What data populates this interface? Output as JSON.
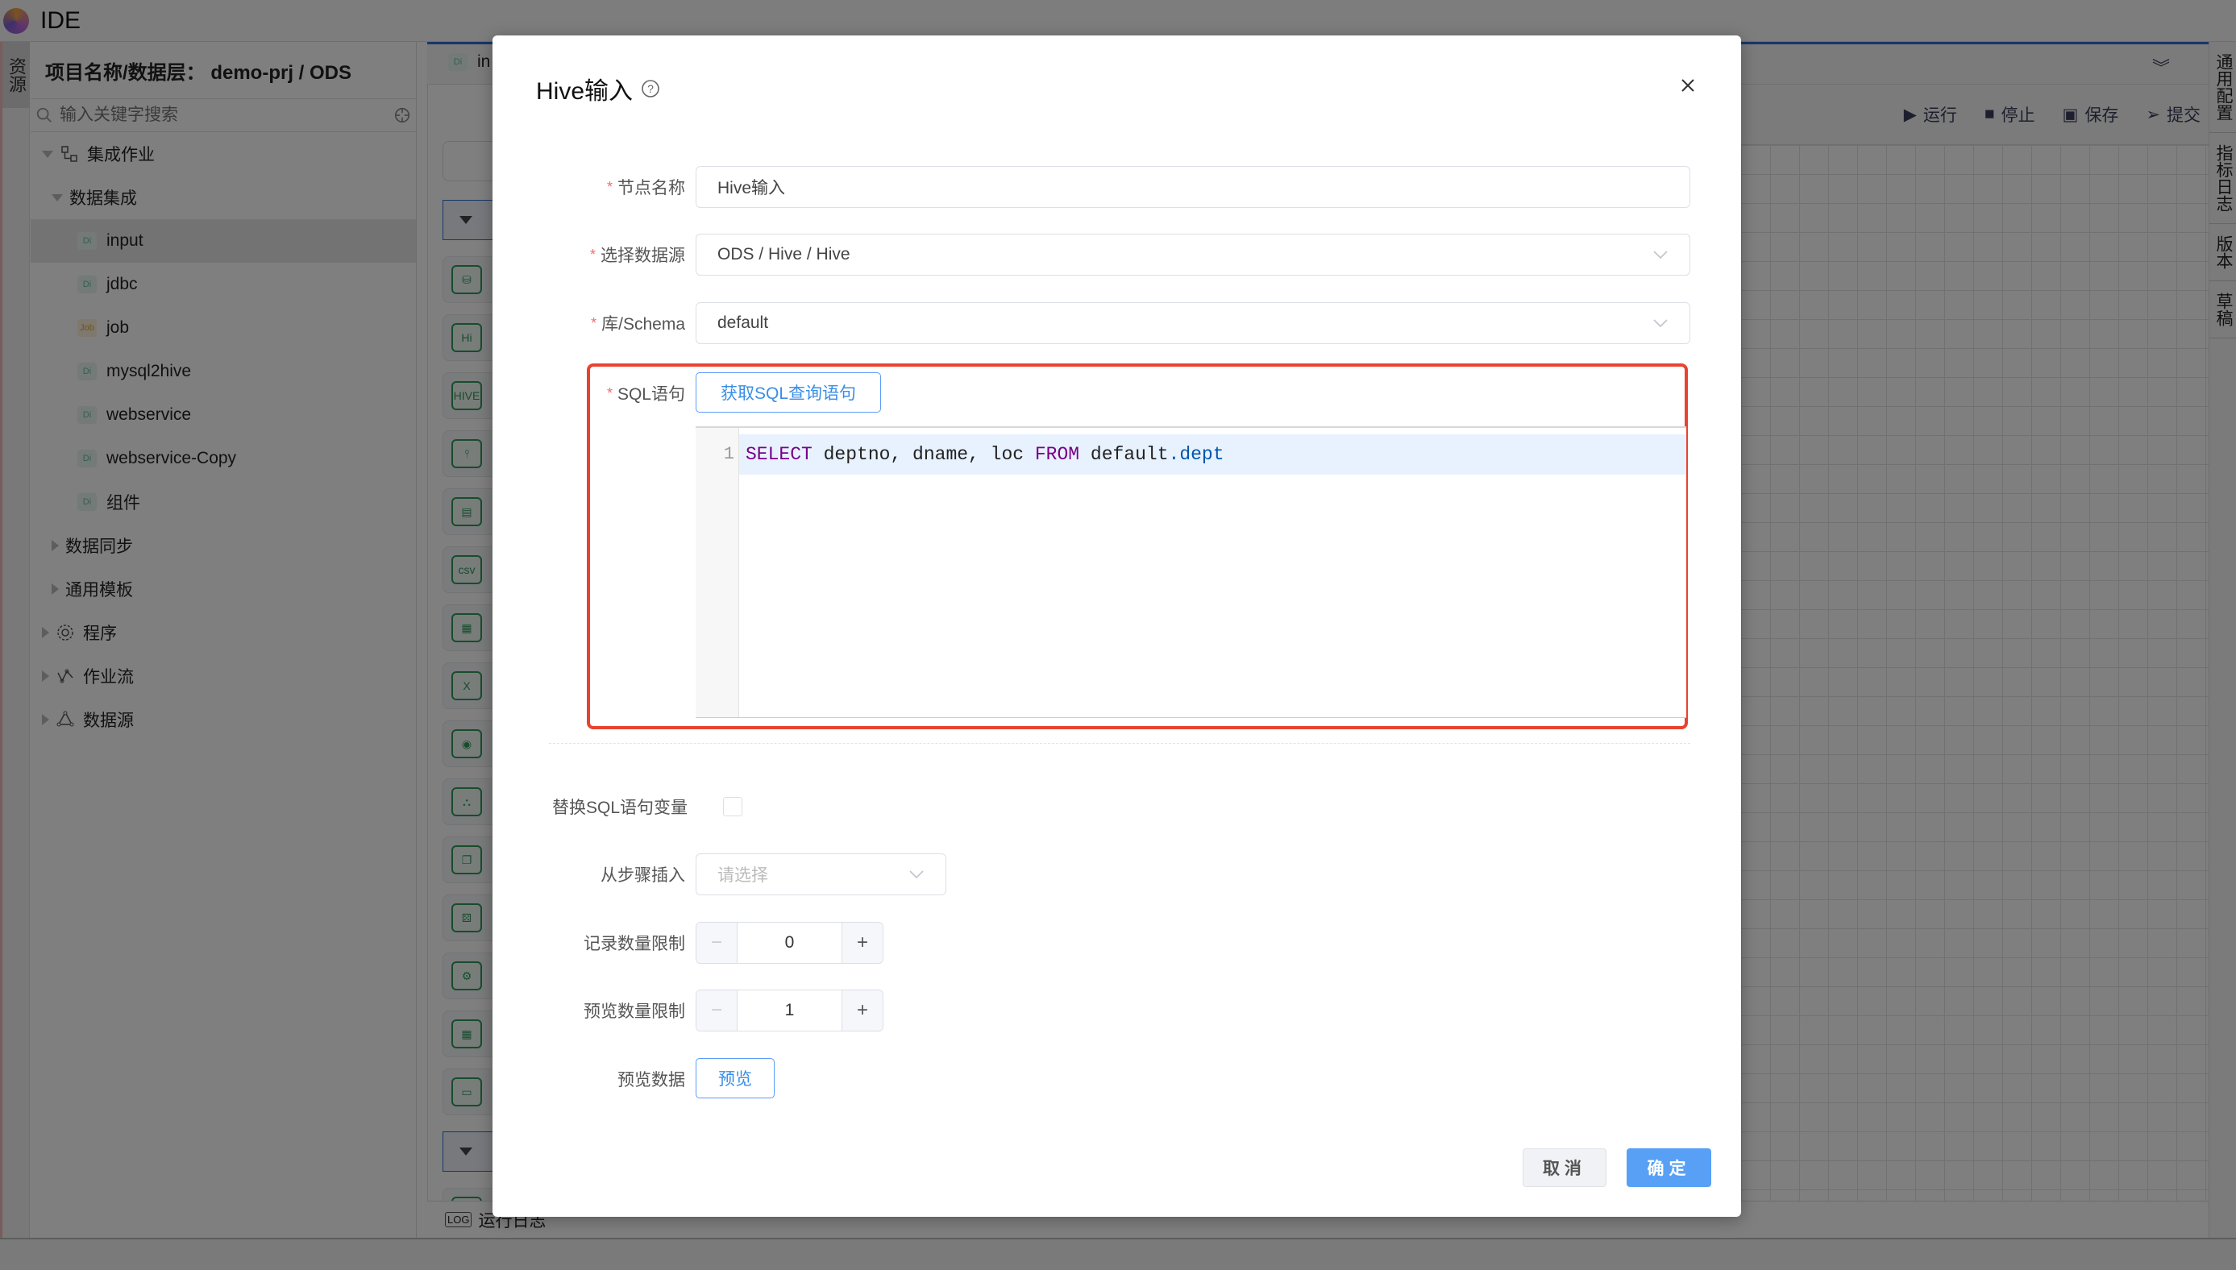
{
  "app": {
    "title": "IDE"
  },
  "left_strip": {
    "tab_label": "资源"
  },
  "resource_panel": {
    "header": "项目名称/数据层：  demo-prj / ODS",
    "search_placeholder": "输入关键字搜索",
    "tree": [
      {
        "label": "集成作业",
        "level": 0,
        "expanded": true,
        "icon": "integration-icon"
      },
      {
        "label": "数据集成",
        "level": 1,
        "expanded": true
      },
      {
        "label": "input",
        "level": 2,
        "badge": "Di",
        "selected": true
      },
      {
        "label": "jdbc",
        "level": 2,
        "badge": "Di"
      },
      {
        "label": "job",
        "level": 2,
        "badge": "Job"
      },
      {
        "label": "mysql2hive",
        "level": 2,
        "badge": "Di"
      },
      {
        "label": "webservice",
        "level": 2,
        "badge": "Di"
      },
      {
        "label": "webservice-Copy",
        "level": 2,
        "badge": "Di"
      },
      {
        "label": "组件",
        "level": 2,
        "badge": "Di"
      },
      {
        "label": "数据同步",
        "level": 1,
        "expanded": false
      },
      {
        "label": "通用模板",
        "level": 1,
        "expanded": false
      },
      {
        "label": "程序",
        "level": 0,
        "expanded": false,
        "icon": "gear-icon"
      },
      {
        "label": "作业流",
        "level": 0,
        "expanded": false,
        "icon": "workflow-icon"
      },
      {
        "label": "数据源",
        "level": 0,
        "expanded": false,
        "icon": "datasource-icon"
      }
    ]
  },
  "editor_tab": {
    "badge": "Di",
    "label": "in"
  },
  "component_panel": {
    "items": [
      {
        "icon": "db-input-icon",
        "glyph": "⛁"
      },
      {
        "icon": "hi-icon",
        "glyph": "Hi"
      },
      {
        "icon": "hive-icon",
        "glyph": "HIVE"
      },
      {
        "icon": "jdbc-icon",
        "glyph": "⫯"
      },
      {
        "icon": "file-input-icon",
        "glyph": "▤"
      },
      {
        "icon": "csv-icon",
        "glyph": "csv"
      },
      {
        "icon": "table-icon",
        "glyph": "▦"
      },
      {
        "icon": "excel-icon",
        "glyph": "X"
      },
      {
        "icon": "json-icon",
        "glyph": "◉"
      },
      {
        "icon": "graph-icon",
        "glyph": "⛬"
      },
      {
        "icon": "copy-icon",
        "glyph": "❐"
      },
      {
        "icon": "random-icon",
        "glyph": "⚄"
      },
      {
        "icon": "system-icon",
        "glyph": "⚙"
      },
      {
        "icon": "table-input-icon",
        "glyph": "▦"
      },
      {
        "icon": "folder-input-icon",
        "glyph": "▭"
      }
    ],
    "last_item": {
      "icon": "db-output-icon",
      "glyph": "⛁"
    }
  },
  "toolbar": {
    "run": "运行",
    "stop": "停止",
    "save": "保存",
    "submit": "提交"
  },
  "bottom": {
    "run_log": "运行日志"
  },
  "right_strip": {
    "tabs": [
      "通用配置",
      "指标日志",
      "版本",
      "草稿"
    ]
  },
  "modal": {
    "title": "Hive输入",
    "fields": {
      "node_name": {
        "label": "节点名称",
        "required": true,
        "value": "Hive输入"
      },
      "datasource": {
        "label": "选择数据源",
        "required": true,
        "value": "ODS / Hive / Hive"
      },
      "schema": {
        "label": "库/Schema",
        "required": true,
        "value": "default"
      },
      "sql": {
        "label": "SQL语句",
        "required": true,
        "fetch_button": "获取SQL查询语句",
        "line_number": "1",
        "tokens": {
          "select": "SELECT",
          "columns": " deptno, dname, loc ",
          "from": "FROM",
          "schema": " default",
          "table": ".dept"
        }
      },
      "replace_vars": {
        "label": "替换SQL语句变量",
        "checked": false
      },
      "insert_from_step": {
        "label": "从步骤插入",
        "placeholder": "请选择"
      },
      "record_limit": {
        "label": "记录数量限制",
        "value": "0",
        "minus": "−",
        "plus": "+"
      },
      "preview_limit": {
        "label": "预览数量限制",
        "value": "1",
        "minus": "−",
        "plus": "+"
      },
      "preview_data": {
        "label": "预览数据",
        "button": "预览"
      }
    },
    "footer": {
      "cancel": "取消",
      "ok": "确定"
    },
    "highlight_color": "#e8432e",
    "primary_color": "#58a0f5"
  }
}
